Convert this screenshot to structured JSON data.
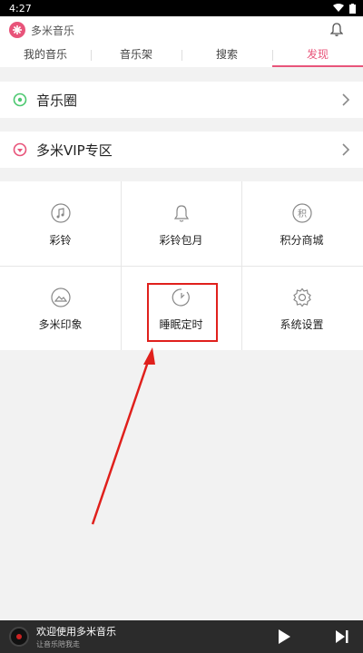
{
  "status_bar": {
    "time": "4:27"
  },
  "app_bar": {
    "title": "多米音乐"
  },
  "tabs": [
    {
      "label": "我的音乐",
      "active": false
    },
    {
      "label": "音乐架",
      "active": false
    },
    {
      "label": "搜索",
      "active": false
    },
    {
      "label": "发现",
      "active": true
    }
  ],
  "rows": {
    "music_circle": {
      "label": "音乐圈",
      "icon": "music-circle-icon"
    },
    "vip_zone": {
      "label": "多米VIP专区",
      "icon": "vip-icon"
    }
  },
  "grid": [
    {
      "label": "彩铃",
      "icon": "music-note-icon"
    },
    {
      "label": "彩铃包月",
      "icon": "bell-icon"
    },
    {
      "label": "积分商城",
      "icon": "points-icon"
    },
    {
      "label": "多米印象",
      "icon": "image-icon"
    },
    {
      "label": "睡眠定时",
      "icon": "timer-icon"
    },
    {
      "label": "系统设置",
      "icon": "gear-icon"
    }
  ],
  "player": {
    "title": "欢迎使用多米音乐",
    "subtitle": "让音乐陪我走"
  },
  "colors": {
    "accent": "#e8547a",
    "highlight": "#e0201c",
    "green": "#4cc870"
  }
}
